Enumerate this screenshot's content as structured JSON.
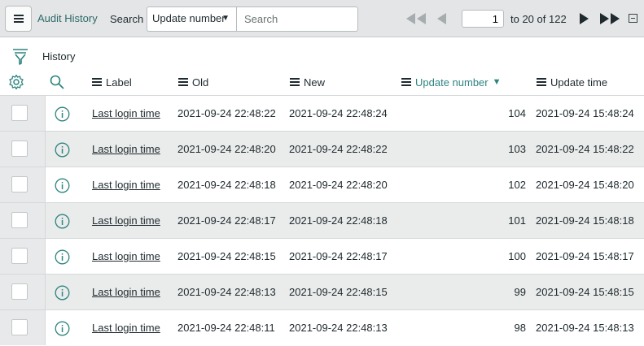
{
  "header": {
    "title": "Audit History",
    "search_label": "Search",
    "search_field": "Update number",
    "search_placeholder": "Search",
    "page_value": "1",
    "page_of": "to 20 of 122"
  },
  "filter": {
    "breadcrumb": "History"
  },
  "columns": {
    "label": "Label",
    "old": "Old",
    "new": "New",
    "update_number": "Update number",
    "update_time": "Update time"
  },
  "rows": [
    {
      "label": "Last login time",
      "old": "2021-09-24 22:48:22",
      "new": "2021-09-24 22:48:24",
      "update_number": "104",
      "update_time": "2021-09-24 15:48:24"
    },
    {
      "label": "Last login time",
      "old": "2021-09-24 22:48:20",
      "new": "2021-09-24 22:48:22",
      "update_number": "103",
      "update_time": "2021-09-24 15:48:22"
    },
    {
      "label": "Last login time",
      "old": "2021-09-24 22:48:18",
      "new": "2021-09-24 22:48:20",
      "update_number": "102",
      "update_time": "2021-09-24 15:48:20"
    },
    {
      "label": "Last login time",
      "old": "2021-09-24 22:48:17",
      "new": "2021-09-24 22:48:18",
      "update_number": "101",
      "update_time": "2021-09-24 15:48:18"
    },
    {
      "label": "Last login time",
      "old": "2021-09-24 22:48:15",
      "new": "2021-09-24 22:48:17",
      "update_number": "100",
      "update_time": "2021-09-24 15:48:17"
    },
    {
      "label": "Last login time",
      "old": "2021-09-24 22:48:13",
      "new": "2021-09-24 22:48:15",
      "update_number": "99",
      "update_time": "2021-09-24 15:48:15"
    },
    {
      "label": "Last login time",
      "old": "2021-09-24 22:48:11",
      "new": "2021-09-24 22:48:13",
      "update_number": "98",
      "update_time": "2021-09-24 15:48:13"
    }
  ],
  "icons": {
    "menu": "hamburger-icon",
    "first": "first-page-icon",
    "prev": "previous-page-icon",
    "next": "next-page-icon",
    "last": "last-page-icon",
    "collapse": "collapse-icon",
    "filter": "filter-icon",
    "settings": "gear-icon",
    "search": "search-icon",
    "info": "info-icon",
    "sort": "sort-descending-icon"
  },
  "colors": {
    "accent": "#2e8481",
    "title": "#2e6a6a",
    "header_bg": "#e3e5e6"
  }
}
